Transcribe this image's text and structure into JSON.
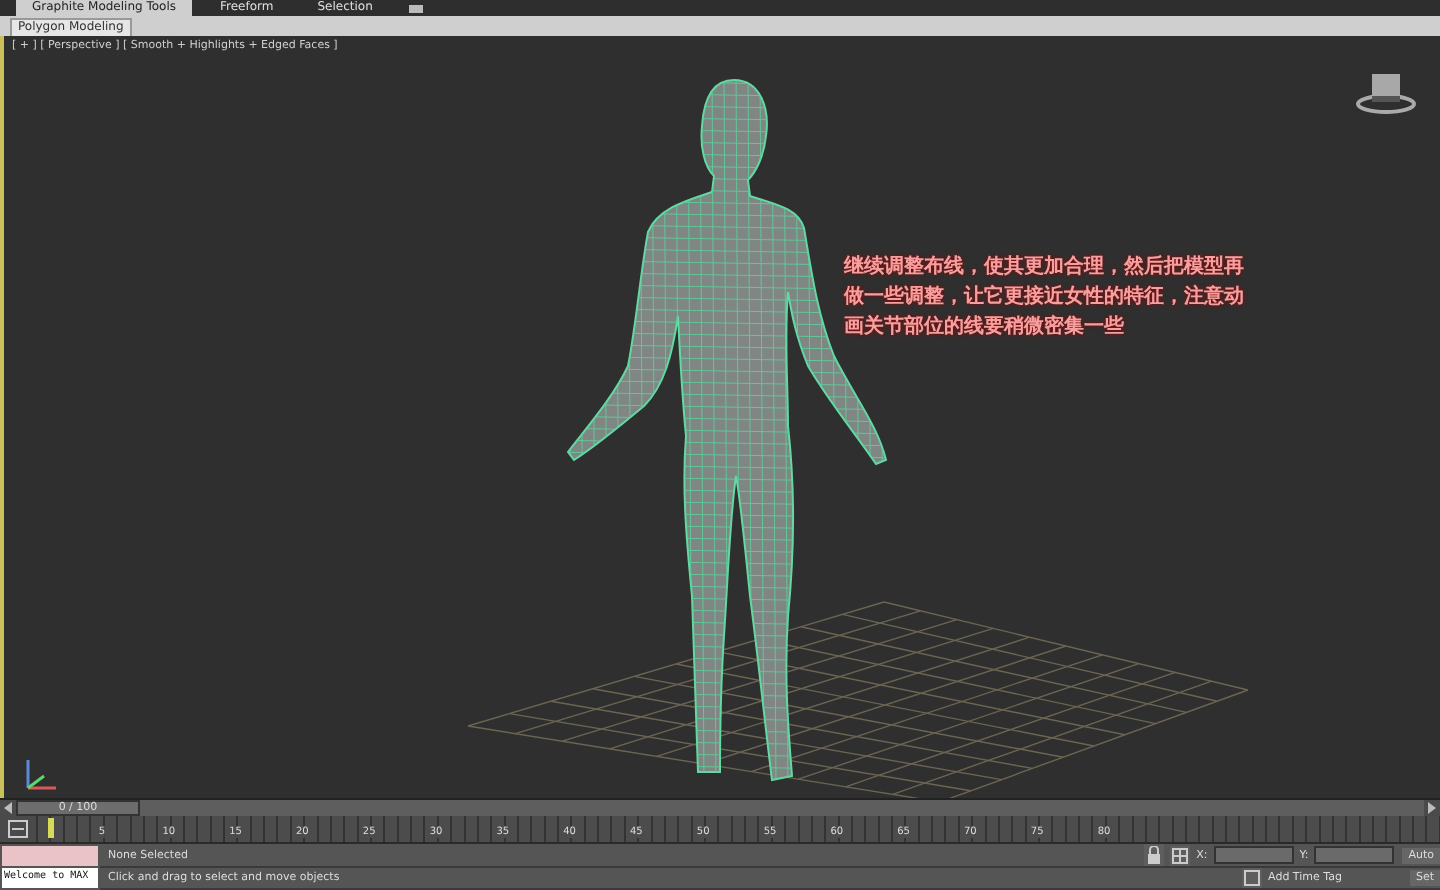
{
  "ribbon": {
    "tabs": [
      {
        "label": "Graphite Modeling Tools",
        "selected": true
      },
      {
        "label": "Freeform",
        "selected": false
      },
      {
        "label": "Selection",
        "selected": false
      }
    ],
    "panel": "Polygon Modeling"
  },
  "viewport": {
    "label": "[ + ] [ Perspective ] [ Smooth + Highlights + Edged Faces ]",
    "annotation": "继续调整布线，使其更加合理，然后把模型再做一些调整，让它更接近女性的特征，注意动画关节部位的线要稍微密集一些"
  },
  "time_slider": {
    "position": "0 / 100",
    "level": 0
  },
  "timeline": {
    "ticks": [
      "5",
      "10",
      "15",
      "20",
      "25",
      "30",
      "35",
      "40",
      "45",
      "50",
      "55",
      "60",
      "65",
      "70",
      "75",
      "80"
    ]
  },
  "status": {
    "listener": "Welcome to MAX",
    "selection": "None Selected",
    "prompt": "Click and drag to select and move objects",
    "coords": [
      {
        "axis": "X:"
      },
      {
        "axis": "Y:"
      }
    ],
    "time_tag": "Add Time Tag",
    "buttons": [
      "Auto",
      "Set"
    ]
  }
}
